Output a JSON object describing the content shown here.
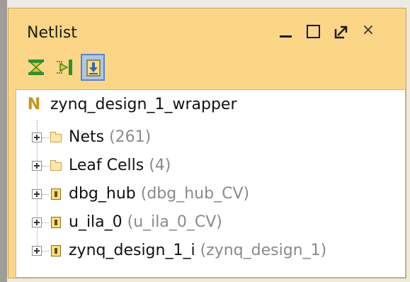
{
  "panel": {
    "title": "Netlist",
    "window_controls": {
      "minimize": "minimize-icon",
      "maximize": "maximize-icon",
      "float": "float-window-icon",
      "close": "×"
    }
  },
  "toolbar": {
    "buttons": [
      {
        "name": "collapse-all-icon",
        "active": false
      },
      {
        "name": "expand-all-icon",
        "active": false
      },
      {
        "name": "auto-update-icon",
        "active": true
      }
    ]
  },
  "tree": {
    "root": {
      "icon": "N",
      "label": "zynq_design_1_wrapper"
    },
    "children": [
      {
        "label": "Nets",
        "suffix": "(261)",
        "icon": "folder-icon"
      },
      {
        "label": "Leaf Cells",
        "suffix": "(4)",
        "icon": "folder-icon"
      },
      {
        "label": "dbg_hub",
        "suffix": "(dbg_hub_CV)",
        "icon": "cell-icon"
      },
      {
        "label": "u_ila_0",
        "suffix": "(u_ila_0_CV)",
        "icon": "cell-icon"
      },
      {
        "label": "zynq_design_1_i",
        "suffix": "(zynq_design_1)",
        "icon": "cell-icon"
      }
    ]
  },
  "colors": {
    "panel_bg": "#fbd686",
    "tree_bg": "#ffffff",
    "secondary_text": "#8a8a8a",
    "active_button": "#a9c8f0"
  }
}
